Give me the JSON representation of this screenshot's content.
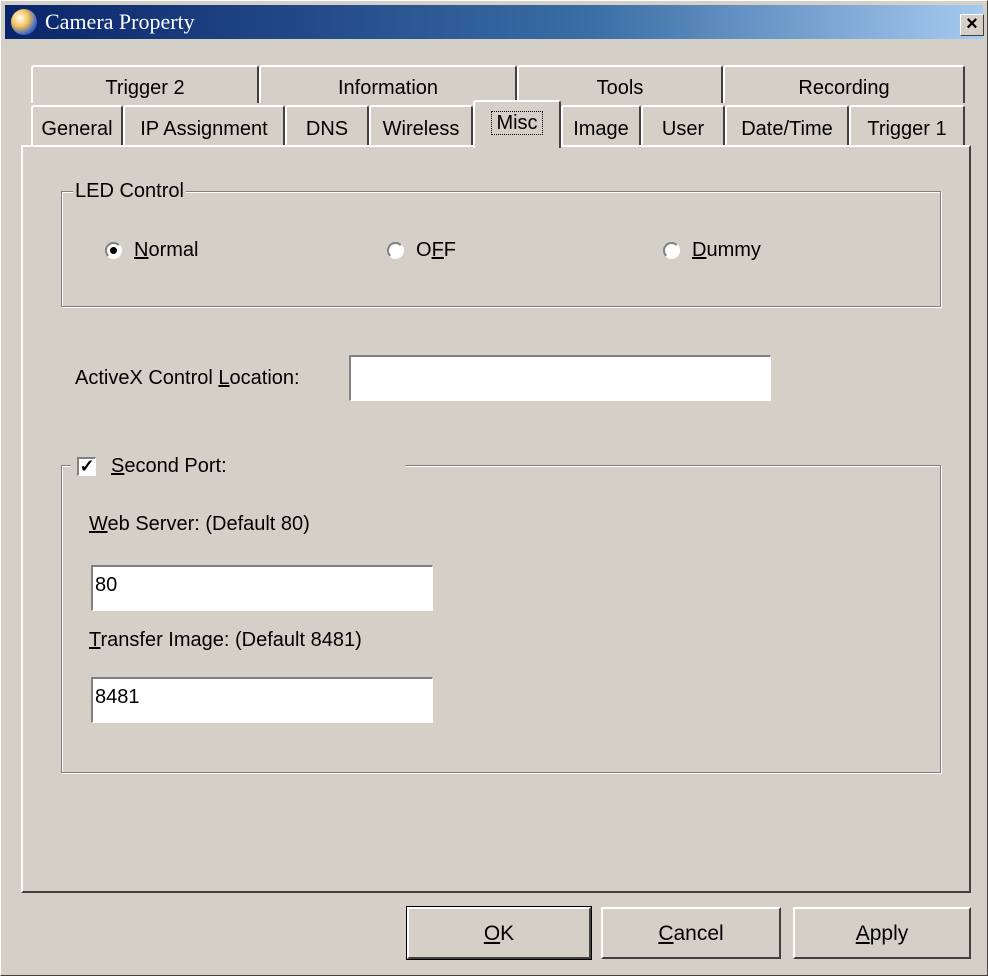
{
  "window": {
    "title": "Camera Property",
    "close_glyph": "×"
  },
  "tabs": {
    "row1": [
      "Trigger 2",
      "Information",
      "Tools",
      "Recording"
    ],
    "row2": [
      "General",
      "IP Assignment",
      "DNS",
      "Wireless",
      "Misc",
      "Image",
      "User",
      "Date/Time",
      "Trigger 1"
    ],
    "active": "Misc"
  },
  "led_control": {
    "group_label": "LED Control",
    "options": [
      {
        "pre": "",
        "mnemonic": "N",
        "post": "ormal",
        "checked": true
      },
      {
        "pre": "O",
        "mnemonic": "F",
        "post": "F",
        "checked": false
      },
      {
        "pre": "",
        "mnemonic": "D",
        "post": "ummy",
        "checked": false
      }
    ]
  },
  "activex": {
    "label_pre": "ActiveX Control ",
    "label_mnemonic": "L",
    "label_post": "ocation:",
    "value": ""
  },
  "second_port": {
    "checked": true,
    "check_glyph": "✓",
    "label_mnemonic": "S",
    "label_post": "econd Port:",
    "web_server_mnemonic": "W",
    "web_server_post": "eb Server: (Default 80)",
    "web_server_value": "80",
    "transfer_mnemonic": "T",
    "transfer_post": "ransfer Image: (Default 8481)",
    "transfer_value": "8481"
  },
  "buttons": {
    "ok_mnemonic": "O",
    "ok_post": "K",
    "cancel_mnemonic": "C",
    "cancel_post": "ancel",
    "apply_mnemonic": "A",
    "apply_post": "pply"
  }
}
